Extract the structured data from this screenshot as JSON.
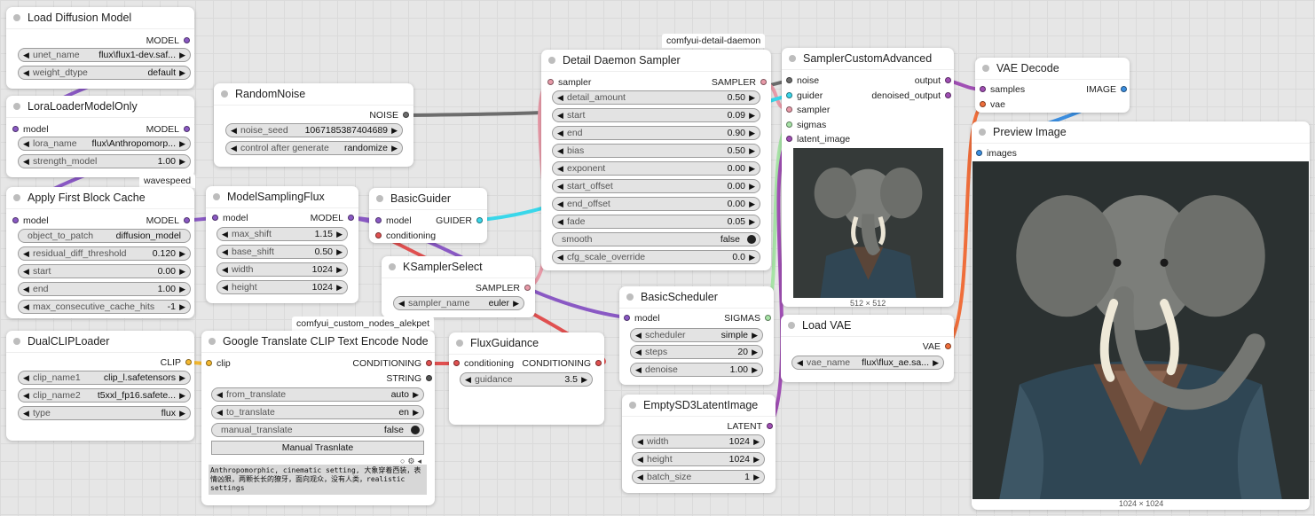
{
  "colors": {
    "model": "#8a59c4",
    "clip": "#f5b930",
    "conditioning": "#e05050",
    "noise": "#6c6c6c",
    "sampler": "#e89aa8",
    "guider": "#39d7ea",
    "sigmas": "#a7e3a6",
    "latent": "#a04fb4",
    "image": "#3c8fe0",
    "vae": "#ef6e3b",
    "string": "#555555"
  },
  "nodes": {
    "load_diffusion": {
      "title": "Load Diffusion Model",
      "out_model": "MODEL",
      "unet_label": "unet_name",
      "unet_value": "flux\\flux1-dev.saf...",
      "dtype_label": "weight_dtype",
      "dtype_value": "default"
    },
    "lora": {
      "title": "LoraLoaderModelOnly",
      "in_model": "model",
      "out_model": "MODEL",
      "lora_label": "lora_name",
      "lora_value": "flux\\Anthropomorp...",
      "strength_label": "strength_model",
      "strength_value": "1.00"
    },
    "random_noise": {
      "title": "RandomNoise",
      "out_noise": "NOISE",
      "seed_label": "noise_seed",
      "seed_value": "1067185387404689",
      "control_label": "control after generate",
      "control_value": "randomize"
    },
    "first_block_cache": {
      "badge": "wavespeed",
      "title": "Apply First Block Cache",
      "in_model": "model",
      "out_model": "MODEL",
      "object_label": "object_to_patch",
      "object_value": "diffusion_model",
      "threshold_label": "residual_diff_threshold",
      "threshold_value": "0.120",
      "start_label": "start",
      "start_value": "0.00",
      "end_label": "end",
      "end_value": "1.00",
      "max_label": "max_consecutive_cache_hits",
      "max_value": "-1"
    },
    "model_sampling": {
      "title": "ModelSamplingFlux",
      "in_model": "model",
      "out_model": "MODEL",
      "max_shift_label": "max_shift",
      "max_shift_value": "1.15",
      "base_shift_label": "base_shift",
      "base_shift_value": "0.50",
      "width_label": "width",
      "width_value": "1024",
      "height_label": "height",
      "height_value": "1024"
    },
    "basic_guider": {
      "title": "BasicGuider",
      "in_model": "model",
      "in_conditioning": "conditioning",
      "out_guider": "GUIDER"
    },
    "ksampler_select": {
      "title": "KSamplerSelect",
      "out_sampler": "SAMPLER",
      "sampler_label": "sampler_name",
      "sampler_value": "euler"
    },
    "detail_daemon": {
      "badge": "comfyui-detail-daemon",
      "title": "Detail Daemon Sampler",
      "in_sampler": "sampler",
      "out_sampler": "SAMPLER",
      "widgets": [
        {
          "label": "detail_amount",
          "value": "0.50"
        },
        {
          "label": "start",
          "value": "0.09"
        },
        {
          "label": "end",
          "value": "0.90"
        },
        {
          "label": "bias",
          "value": "0.50"
        },
        {
          "label": "exponent",
          "value": "0.00"
        },
        {
          "label": "start_offset",
          "value": "0.00"
        },
        {
          "label": "end_offset",
          "value": "0.00"
        },
        {
          "label": "fade",
          "value": "0.05"
        }
      ],
      "smooth_label": "smooth",
      "smooth_value": "false",
      "cfg_label": "cfg_scale_override",
      "cfg_value": "0.0"
    },
    "sampler_custom": {
      "title": "SamplerCustomAdvanced",
      "in_noise": "noise",
      "in_guider": "guider",
      "in_sampler": "sampler",
      "in_sigmas": "sigmas",
      "in_latent": "latent_image",
      "out_output": "output",
      "out_denoised": "denoised_output",
      "preview_size": "512 × 512"
    },
    "vae_decode": {
      "title": "VAE Decode",
      "in_samples": "samples",
      "in_vae": "vae",
      "out_image": "IMAGE"
    },
    "preview_image": {
      "title": "Preview Image",
      "in_images": "images",
      "image_size": "1024 × 1024"
    },
    "dual_clip": {
      "title": "DualCLIPLoader",
      "out_clip": "CLIP",
      "clip1_label": "clip_name1",
      "clip1_value": "clip_l.safetensors",
      "clip2_label": "clip_name2",
      "clip2_value": "t5xxl_fp16.safete...",
      "type_label": "type",
      "type_value": "flux"
    },
    "google_translate": {
      "badge": "comfyui_custom_nodes_alekpet",
      "title": "Google Translate CLIP Text Encode Node",
      "in_clip": "clip",
      "out_conditioning": "CONDITIONING",
      "out_string": "STRING",
      "from_label": "from_translate",
      "from_value": "auto",
      "to_label": "to_translate",
      "to_value": "en",
      "manual_label": "manual_translate",
      "manual_value": "false",
      "button_label": "Manual Trasnlate",
      "prompt_text": "Anthropomorphic, cinematic setting, 大象穿着西装，表情凶狠，两颗长长的獠牙，面向观众，没有人类，realistic settings"
    },
    "flux_guidance": {
      "title": "FluxGuidance",
      "in_conditioning": "conditioning",
      "out_conditioning": "CONDITIONING",
      "guidance_label": "guidance",
      "guidance_value": "3.5"
    },
    "basic_scheduler": {
      "title": "BasicScheduler",
      "in_model": "model",
      "out_sigmas": "SIGMAS",
      "scheduler_label": "scheduler",
      "scheduler_value": "simple",
      "steps_label": "steps",
      "steps_value": "20",
      "denoise_label": "denoise",
      "denoise_value": "1.00"
    },
    "load_vae": {
      "title": "Load VAE",
      "out_vae": "VAE",
      "vae_label": "vae_name",
      "vae_value": "flux\\flux_ae.sa..."
    },
    "empty_latent": {
      "title": "EmptySD3LatentImage",
      "out_latent": "LATENT",
      "width_label": "width",
      "width_value": "1024",
      "height_label": "height",
      "height_value": "1024",
      "batch_label": "batch_size",
      "batch_value": "1"
    }
  }
}
